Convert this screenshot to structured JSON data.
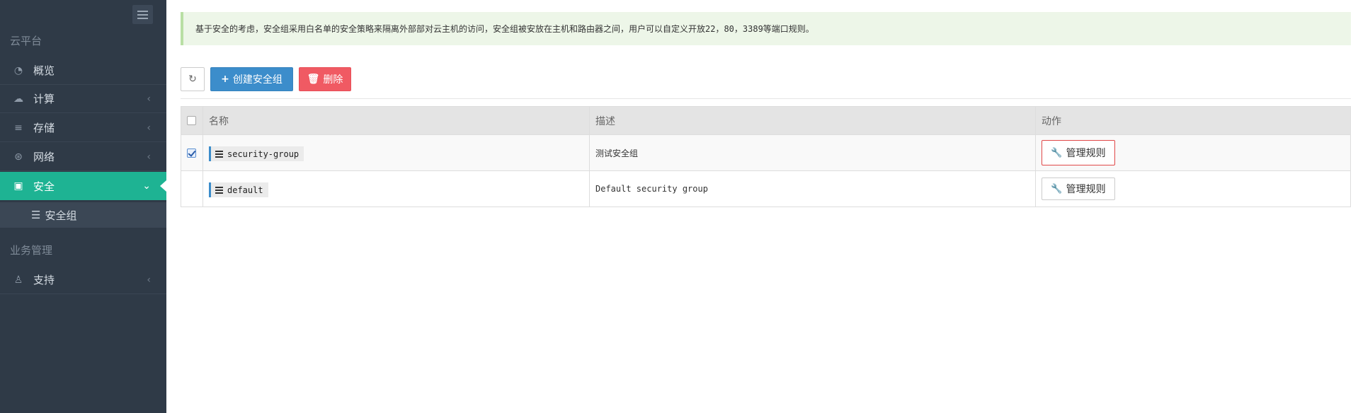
{
  "sidebar": {
    "section_cloud": "云平台",
    "section_business": "业务管理",
    "items": [
      {
        "label": "概览",
        "icon": "dashboard-icon"
      },
      {
        "label": "计算",
        "icon": "cloud-icon"
      },
      {
        "label": "存储",
        "icon": "database-icon"
      },
      {
        "label": "网络",
        "icon": "network-icon"
      },
      {
        "label": "安全",
        "icon": "medkit-icon"
      },
      {
        "label": "支持",
        "icon": "support-icon"
      }
    ],
    "submenu": {
      "label": "安全组",
      "icon": "list-icon"
    }
  },
  "notice": {
    "text": "基于安全的考虑，安全组采用白名单的安全策略来隔离外部部对云主机的访问，安全组被安放在主机和路由器之间，用户可以自定义开放22，80，3389等端口规则。"
  },
  "toolbar": {
    "create_label": "创建安全组",
    "delete_label": "删除"
  },
  "table": {
    "headers": {
      "name": "名称",
      "description": "描述",
      "action": "动作"
    },
    "rows": [
      {
        "name": "security-group",
        "description": "测试安全组",
        "action": "管理规则",
        "checked": true
      },
      {
        "name": "default",
        "description": "Default security group",
        "action": "管理规则",
        "checked": false
      }
    ]
  },
  "colors": {
    "sidebar_bg": "#2f3a47",
    "active_menu": "#1eb393",
    "create_button": "#3c8dcb",
    "delete_button": "#f05a63",
    "notice_bg": "#edf6e8"
  }
}
